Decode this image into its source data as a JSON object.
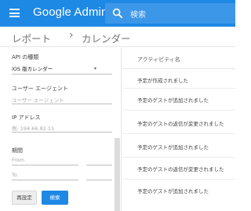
{
  "app": {
    "brand_name": "Google Admin"
  },
  "search": {
    "placeholder": "検索"
  },
  "breadcrumb": {
    "reports": "レポート",
    "separator": "›",
    "calendar": "カレンダー"
  },
  "filters": {
    "api_type": {
      "label": "API の種類",
      "value": "iOS 版カレンダー"
    },
    "user_agent": {
      "label": "ユーザー エージェント",
      "placeholder": "ユーザー エージェント"
    },
    "ip_address": {
      "label": "IP アドレス",
      "placeholder": "例: 194.66.82.11"
    },
    "period": {
      "label": "期間",
      "from_placeholder": "From",
      "to_placeholder": "To"
    },
    "reset_label": "再設定",
    "search_label": "検索"
  },
  "results": {
    "column_header": "アクティビティ名",
    "rows": [
      "予定が作成されました",
      "予定のゲストが追加されました",
      "予定のゲストの返信が変更されました",
      "予定のゲストが追加されました",
      "予定のゲストの返信が変更されました",
      "予定のゲストが追加されました"
    ]
  },
  "colors": {
    "topbar": "#1e88e5",
    "primary_button": "#1e88e5"
  }
}
